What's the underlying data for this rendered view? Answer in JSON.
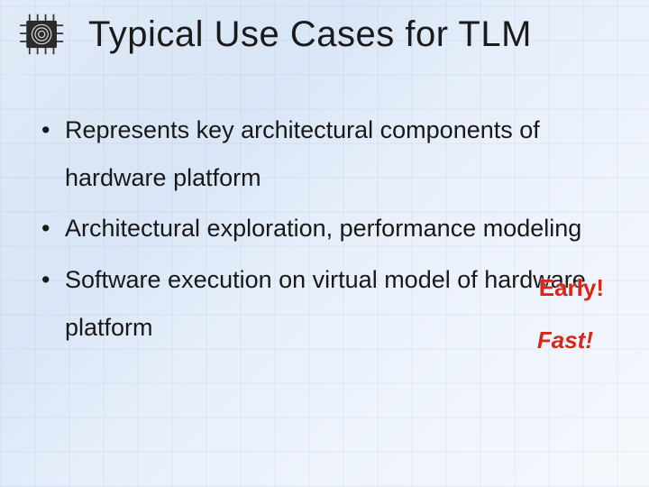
{
  "title": "Typical Use Cases for TLM",
  "bullets": [
    "Represents key architectural components of hardware platform",
    "Architectural exploration, performance modeling",
    "Software execution on virtual model of hardware platform"
  ],
  "callouts": {
    "early": "Early!",
    "fast": "Fast!"
  },
  "bullet_glyph": "•"
}
